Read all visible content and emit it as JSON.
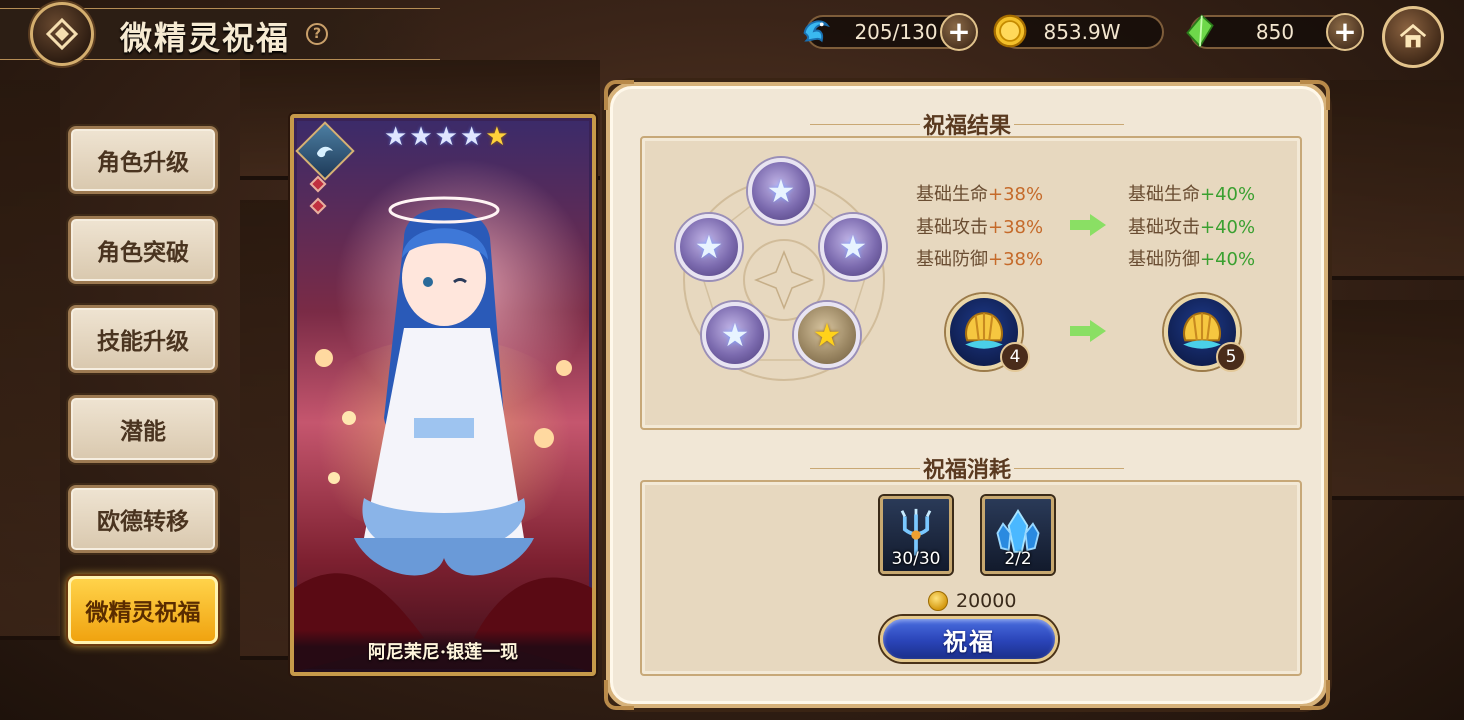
{
  "header": {
    "title": "微精灵祝福",
    "help": "?"
  },
  "resources": {
    "stamina": "205/130",
    "gold": "853.9W",
    "gems": "850"
  },
  "menu": [
    {
      "label": "角色升级"
    },
    {
      "label": "角色突破"
    },
    {
      "label": "技能升级"
    },
    {
      "label": "潜能"
    },
    {
      "label": "欧德转移"
    },
    {
      "label": "微精灵祝福",
      "active": true
    }
  ],
  "character": {
    "name": "阿尼茉尼·银莲一现",
    "stars": 5
  },
  "result": {
    "section_title": "祝福结果",
    "current": [
      {
        "label": "基础生命",
        "value": "+38%"
      },
      {
        "label": "基础攻击",
        "value": "+38%"
      },
      {
        "label": "基础防御",
        "value": "+38%"
      }
    ],
    "next": [
      {
        "label": "基础生命",
        "value": "+40%"
      },
      {
        "label": "基础攻击",
        "value": "+40%"
      },
      {
        "label": "基础防御",
        "value": "+40%"
      }
    ],
    "level_current": "4",
    "level_next": "5"
  },
  "cost": {
    "section_title": "祝福消耗",
    "items": [
      {
        "name": "trident-item",
        "count": "30/30"
      },
      {
        "name": "crystal-item",
        "count": "2/2"
      }
    ],
    "gold": "20000",
    "button_label": "祝福"
  },
  "colors": {
    "accent_gold": "#f0a310",
    "positive": "#3aa030",
    "old_value": "#c56a2a",
    "button_blue": "#2a44b8"
  }
}
